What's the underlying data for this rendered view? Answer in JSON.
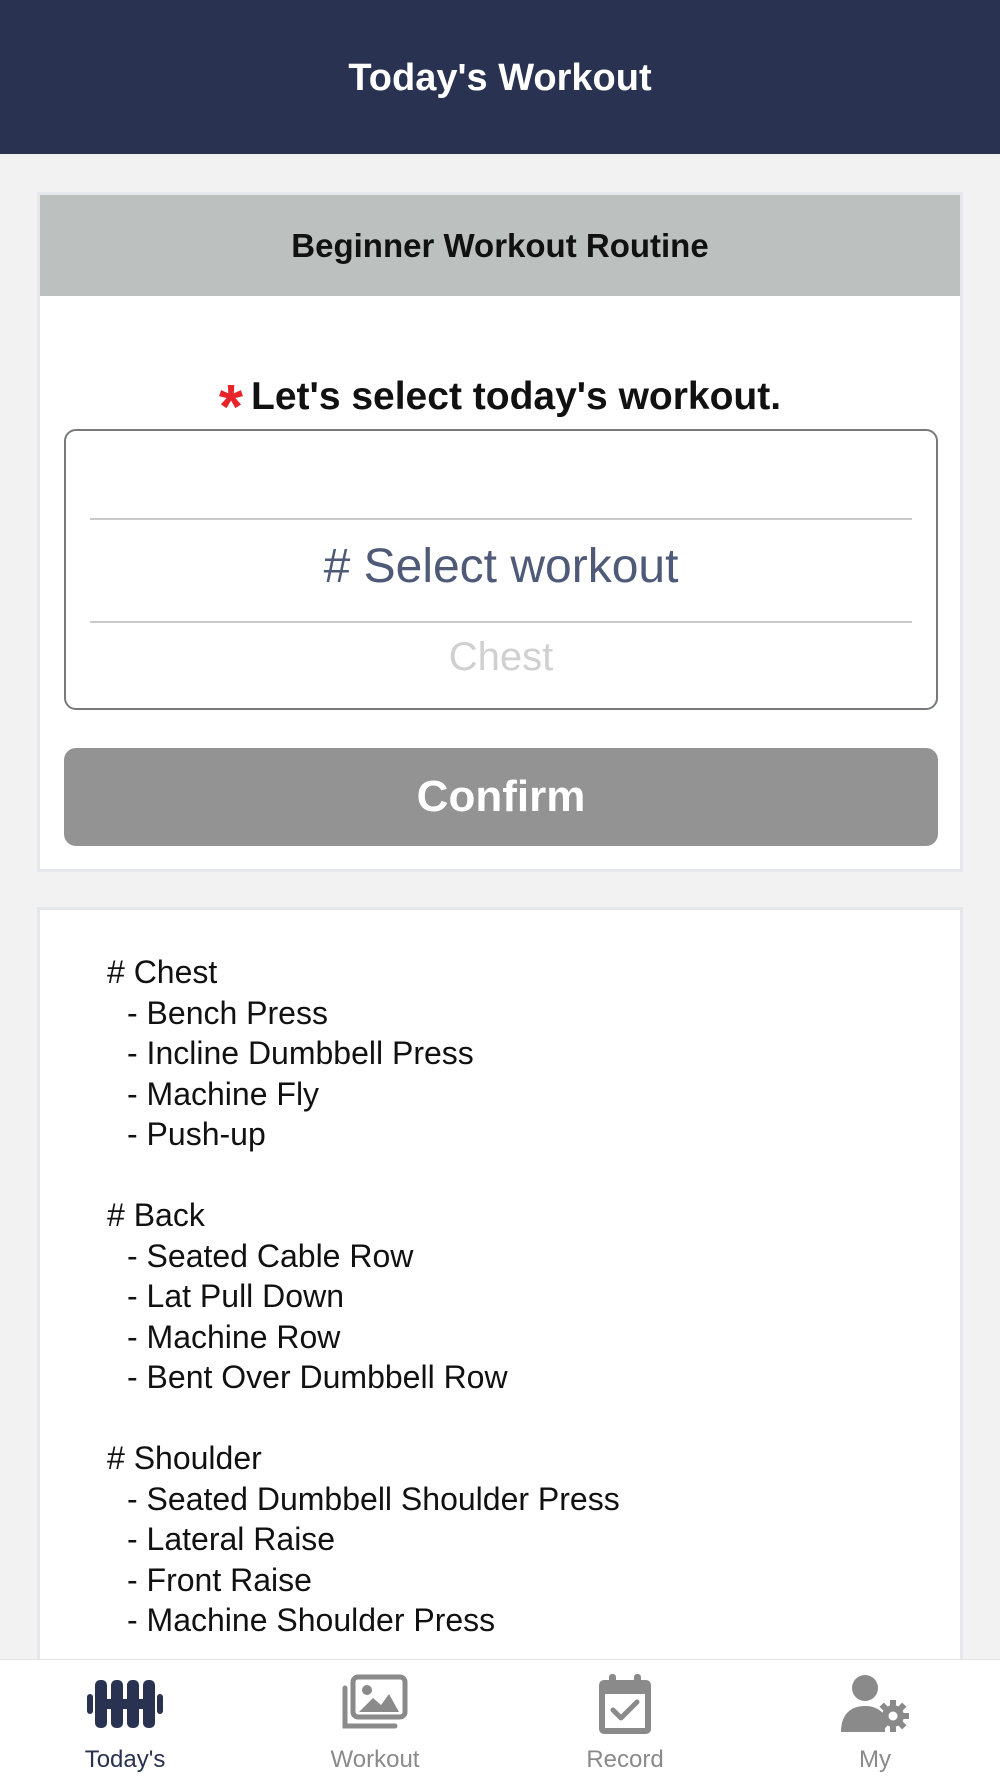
{
  "header": {
    "title": "Today's Workout"
  },
  "routine_card": {
    "title": "Beginner Workout Routine",
    "prompt": "Let's select today's workout.",
    "picker": {
      "selected": "# Select workout",
      "next_option": "Chest"
    },
    "confirm_label": "Confirm"
  },
  "routine_list": [
    {
      "heading": "# Chest",
      "items": [
        "- Bench Press",
        "- Incline Dumbbell Press",
        "- Machine Fly",
        "- Push-up"
      ]
    },
    {
      "heading": "# Back",
      "items": [
        "- Seated Cable Row",
        "- Lat Pull Down",
        "- Machine Row",
        "- Bent Over Dumbbell Row"
      ]
    },
    {
      "heading": "# Shoulder",
      "items": [
        "- Seated Dumbbell Shoulder Press",
        "- Lateral Raise",
        "- Front Raise",
        "- Machine Shoulder Press"
      ]
    }
  ],
  "tabbar": {
    "tabs": [
      {
        "label": "Today's",
        "icon": "dumbbell-icon",
        "active": true
      },
      {
        "label": "Workout",
        "icon": "images-icon",
        "active": false
      },
      {
        "label": "Record",
        "icon": "calendar-check-icon",
        "active": false
      },
      {
        "label": "My",
        "icon": "user-gear-icon",
        "active": false
      }
    ]
  },
  "colors": {
    "header_bg": "#2a3252",
    "accent_active": "#2a3252",
    "asterisk": "#e8232a",
    "confirm_disabled": "#939393"
  }
}
